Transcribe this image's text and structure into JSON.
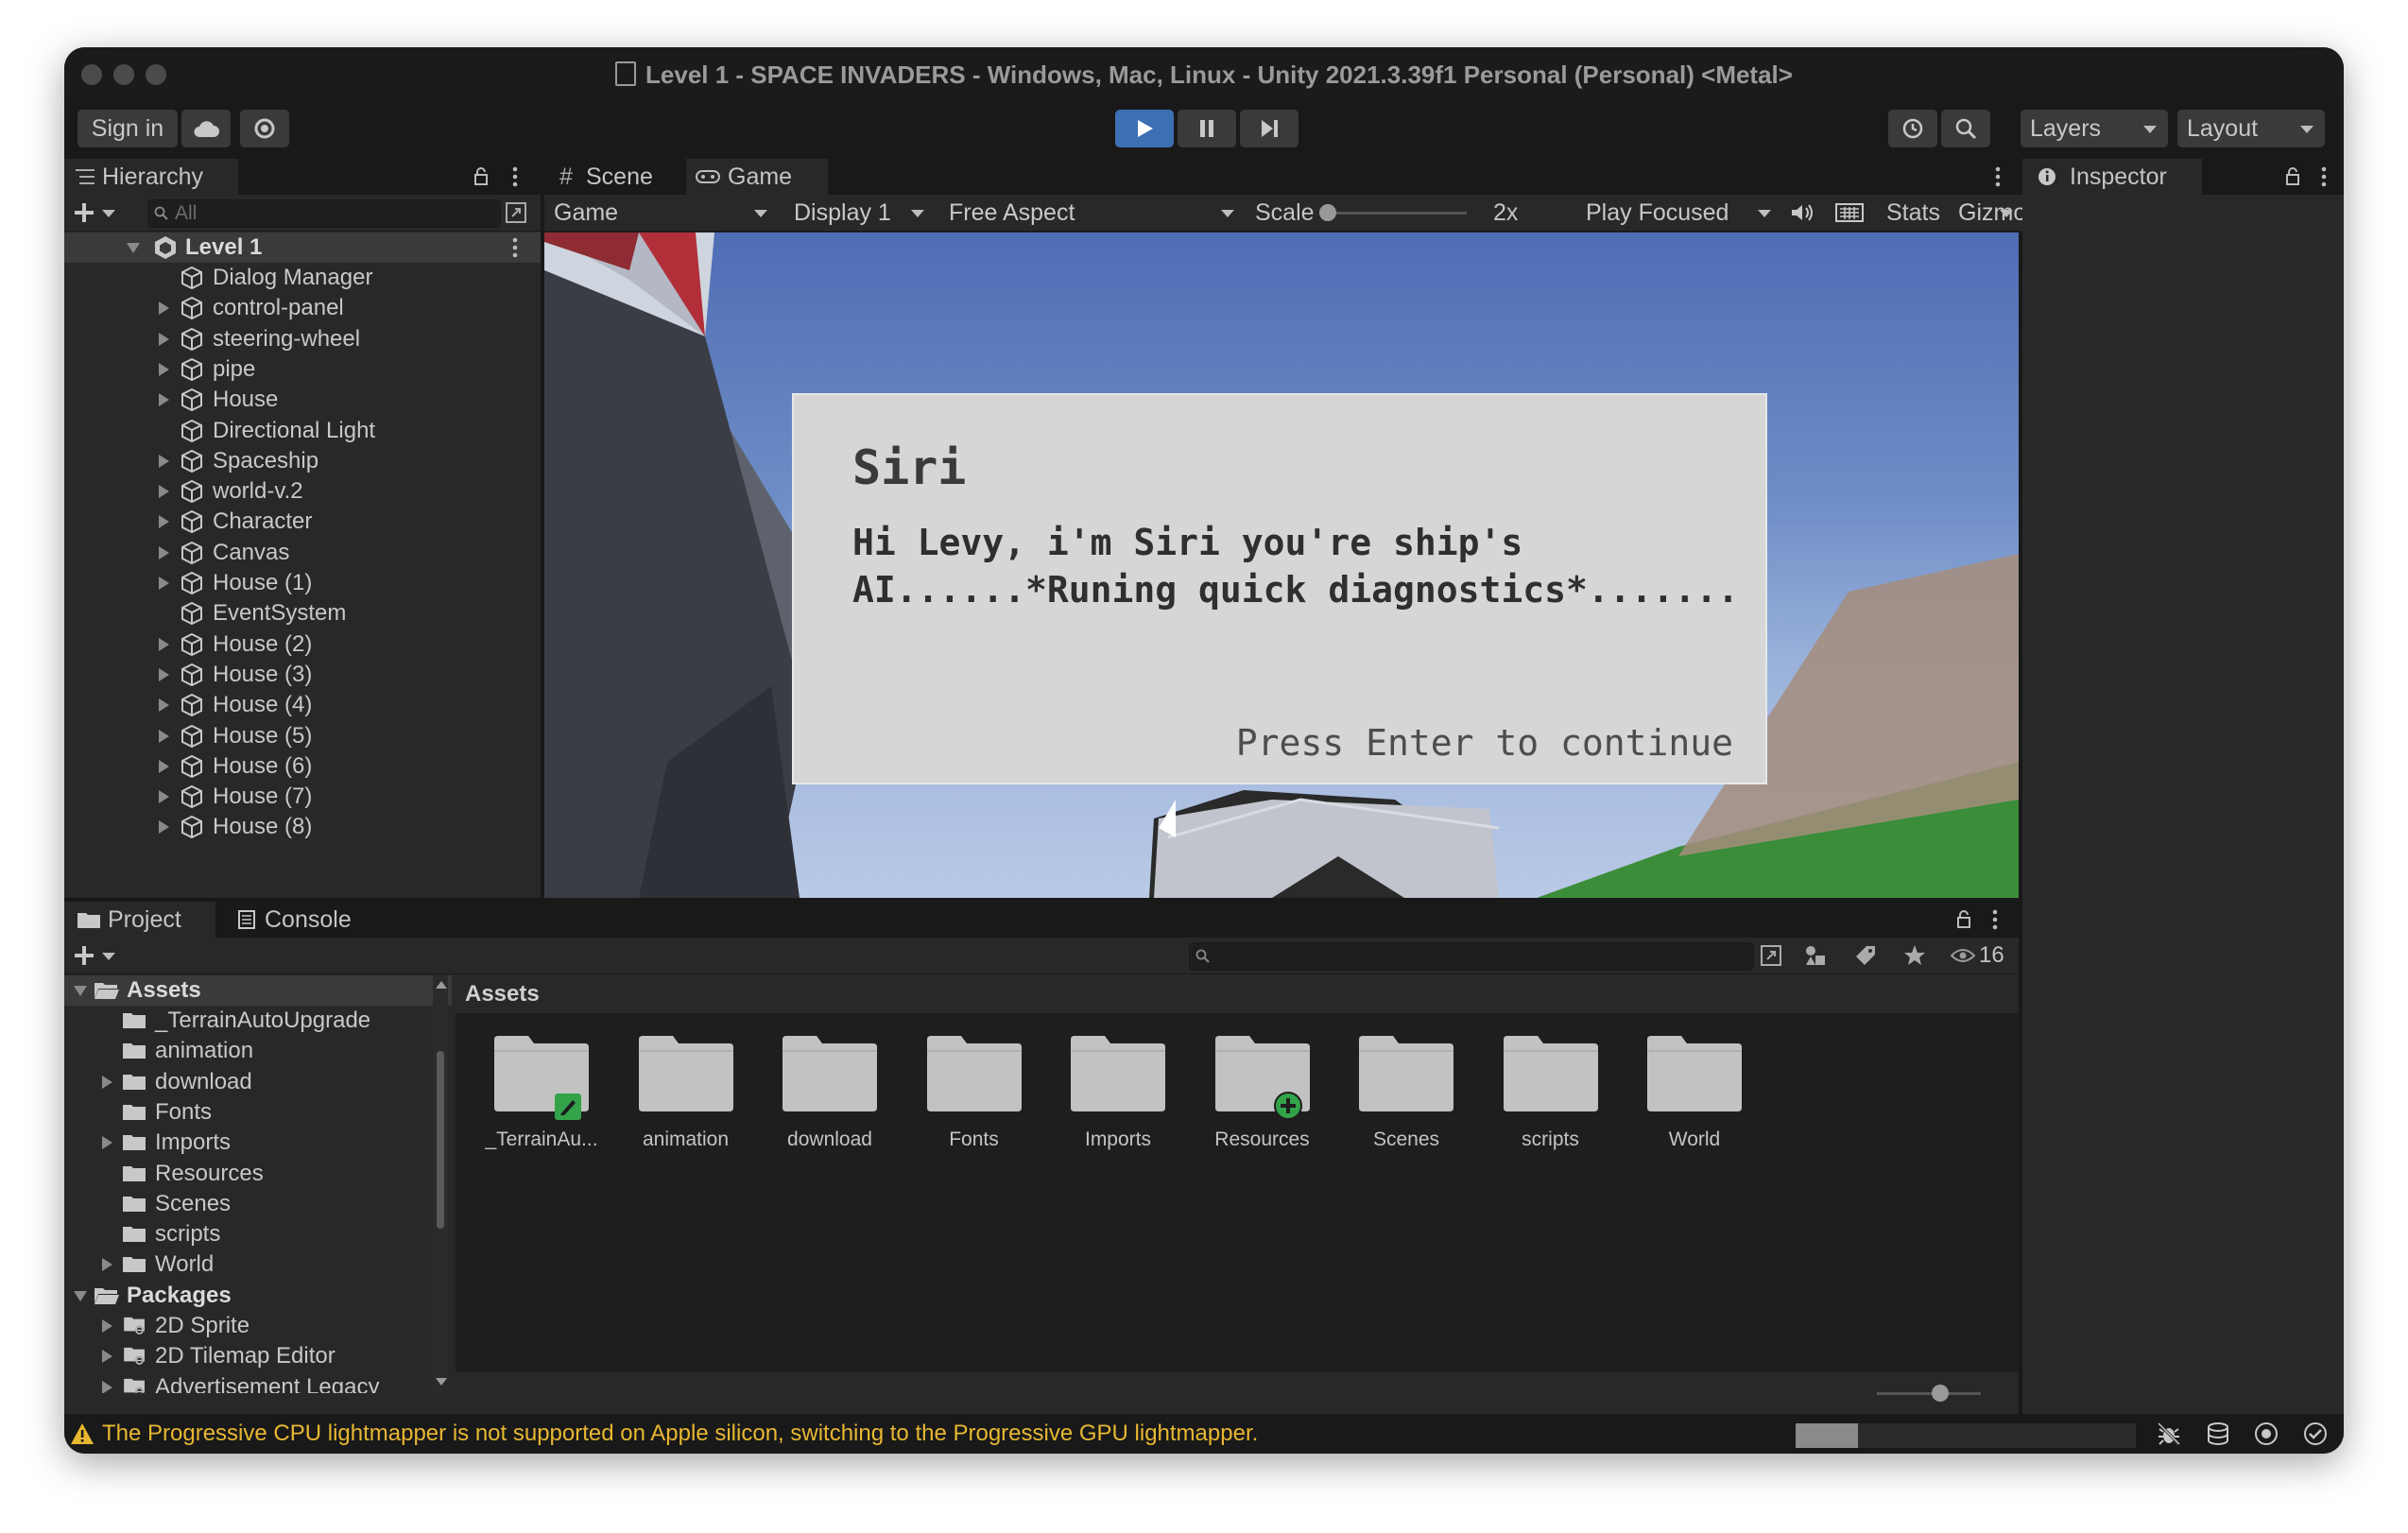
{
  "window": {
    "title": "Level 1 - SPACE INVADERS - Windows, Mac, Linux - Unity 2021.3.39f1 Personal (Personal) <Metal>"
  },
  "toolbar": {
    "sign_in": "Sign in",
    "layers": "Layers",
    "layout": "Layout"
  },
  "hierarchy": {
    "tab": "Hierarchy",
    "search_placeholder": "All",
    "scene": "Level 1",
    "items": [
      {
        "label": "Dialog Manager",
        "expandable": false
      },
      {
        "label": "control-panel",
        "expandable": true
      },
      {
        "label": "steering-wheel",
        "expandable": true
      },
      {
        "label": "pipe",
        "expandable": true
      },
      {
        "label": "House",
        "expandable": true
      },
      {
        "label": "Directional Light",
        "expandable": false
      },
      {
        "label": "Spaceship",
        "expandable": true
      },
      {
        "label": "world-v.2",
        "expandable": true
      },
      {
        "label": "Character",
        "expandable": true
      },
      {
        "label": "Canvas",
        "expandable": true
      },
      {
        "label": "House (1)",
        "expandable": true
      },
      {
        "label": "EventSystem",
        "expandable": false
      },
      {
        "label": "House (2)",
        "expandable": true
      },
      {
        "label": "House (3)",
        "expandable": true
      },
      {
        "label": "House (4)",
        "expandable": true
      },
      {
        "label": "House (5)",
        "expandable": true
      },
      {
        "label": "House (6)",
        "expandable": true
      },
      {
        "label": "House (7)",
        "expandable": true
      },
      {
        "label": "House (8)",
        "expandable": true
      }
    ]
  },
  "game_view": {
    "tabs": {
      "scene": "Scene",
      "game": "Game"
    },
    "controls": {
      "mode": "Game",
      "display": "Display 1",
      "aspect": "Free Aspect",
      "scale_label": "Scale",
      "scale_value": "2x",
      "play_mode": "Play Focused",
      "stats": "Stats",
      "gizmos": "Gizmos"
    },
    "dialog": {
      "speaker": "Siri",
      "line1": "Hi Levy, i'm Siri you're ship's",
      "line2": "AI......*Runing quick diagnostics*.......",
      "prompt": "Press Enter to continue"
    }
  },
  "inspector": {
    "tab": "Inspector"
  },
  "project": {
    "tabs": {
      "project": "Project",
      "console": "Console"
    },
    "visible_count": "16",
    "tree": {
      "assets_root": "Assets",
      "assets": [
        {
          "label": "_TerrainAutoUpgrade",
          "expandable": false
        },
        {
          "label": "animation",
          "expandable": false
        },
        {
          "label": "download",
          "expandable": true
        },
        {
          "label": "Fonts",
          "expandable": false
        },
        {
          "label": "Imports",
          "expandable": true
        },
        {
          "label": "Resources",
          "expandable": false
        },
        {
          "label": "Scenes",
          "expandable": false
        },
        {
          "label": "scripts",
          "expandable": false
        },
        {
          "label": "World",
          "expandable": true
        }
      ],
      "packages_root": "Packages",
      "packages": [
        {
          "label": "2D Sprite"
        },
        {
          "label": "2D Tilemap Editor"
        },
        {
          "label": "Advertisement Legacy"
        }
      ]
    },
    "breadcrumb": "Assets",
    "folders": [
      {
        "label": "_TerrainAu...",
        "badge": "edit"
      },
      {
        "label": "animation",
        "badge": ""
      },
      {
        "label": "download",
        "badge": ""
      },
      {
        "label": "Fonts",
        "badge": ""
      },
      {
        "label": "Imports",
        "badge": ""
      },
      {
        "label": "Resources",
        "badge": "add"
      },
      {
        "label": "Scenes",
        "badge": ""
      },
      {
        "label": "scripts",
        "badge": ""
      },
      {
        "label": "World",
        "badge": ""
      }
    ]
  },
  "status_bar": {
    "message": "The Progressive CPU lightmapper is not supported on Apple silicon, switching to the Progressive GPU lightmapper."
  },
  "colors": {
    "accent": "#3d6fb3",
    "warning": "#e8b732",
    "badge_green": "#33a34a"
  }
}
